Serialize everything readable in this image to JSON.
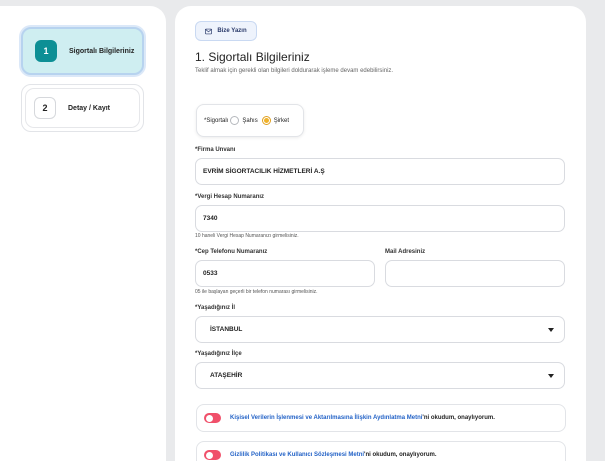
{
  "steps": [
    {
      "number": "1",
      "label": "Sigortalı Bilgileriniz"
    },
    {
      "number": "2",
      "label": "Detay / Kayıt"
    }
  ],
  "header": {
    "contact_button": "Bize Yazın",
    "title": "1. Sigortalı Bilgileriniz",
    "subtitle": "Teklif almak için gerekli olan bilgileri doldurarak işleme devam edebilirsiniz."
  },
  "insured_type": {
    "label": "*Sigortalı",
    "options": [
      "Şahıs",
      "Şirket"
    ],
    "selected": "Şirket"
  },
  "fields": {
    "company_name": {
      "label": "*Firma Unvanı",
      "value": "EVRİM SİGORTACILIK HİZMETLERİ A.Ş"
    },
    "tax_number": {
      "label": "*Vergi Hesap Numaranız",
      "value": "7340",
      "hint": "10 haneli Vergi Hesap Numaranızı girmelisiniz."
    },
    "phone": {
      "label": "*Cep Telefonu Numaranız",
      "value": "0533",
      "hint": "05 ile başlayan geçerli bir telefon numarası girmelisiniz."
    },
    "email": {
      "label": "Mail Adresiniz",
      "value": ""
    },
    "city": {
      "label": "*Yaşadığınız İl",
      "value": "İSTANBUL"
    },
    "district": {
      "label": "*Yaşadığınız İlçe",
      "value": "ATAŞEHİR"
    }
  },
  "consents": [
    {
      "link": "Kişisel Verilerin İşlenmesi ve Aktarılmasına İlişkin Aydınlatma Metni",
      "suffix": " 'ni okudum, onaylıyorum."
    },
    {
      "link": "Gizlilik Politikası ve Kullanıcı Sözleşmesi Metni",
      "suffix": " 'ni okudum, onaylıyorum."
    }
  ],
  "colors": {
    "accent": "#0d8f95",
    "radio_selected": "#f0b22a",
    "toggle": "#f0506a",
    "link": "#2463c7"
  }
}
